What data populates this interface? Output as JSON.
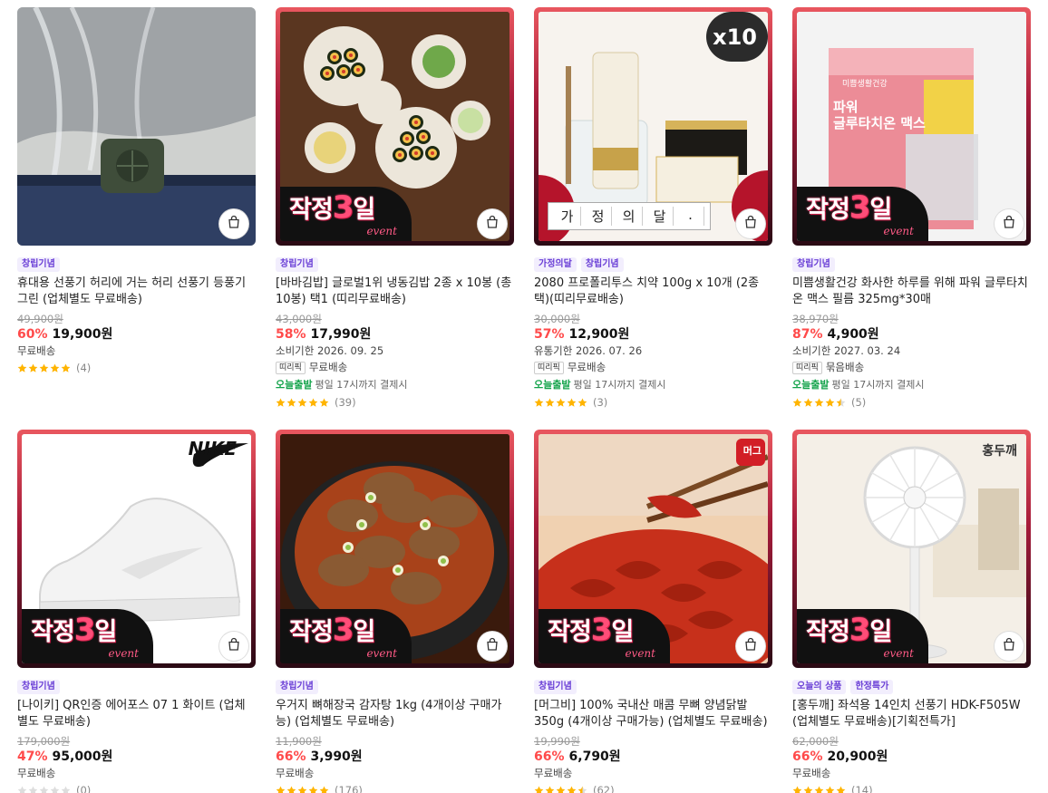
{
  "products": [
    {
      "tags": [
        "창립기념"
      ],
      "title": "휴대용 선풍기 허리에 거는 허리 선풍기 등풍기 그린 (업체별도 무료배송)",
      "original_price": "49,900원",
      "discount": "60%",
      "price": "19,900원",
      "expiry": "",
      "shipping_chip": "",
      "shipping": "무료배송",
      "today_label": "",
      "today_note": "",
      "rating": 5,
      "review_count": "(4)",
      "event_badge": false
    },
    {
      "tags": [
        "창립기념"
      ],
      "title": "[바바김밥] 글로벌1위 냉동김밥 2종 x 10봉 (총 10봉) 택1 (띠리무료배송)",
      "original_price": "43,000원",
      "discount": "58%",
      "price": "17,990원",
      "expiry": "소비기한 2026. 09. 25",
      "shipping_chip": "띠리픽",
      "shipping": "무료배송",
      "today_label": "오늘출발",
      "today_note": "평일 17시까지 결제시",
      "rating": 5,
      "review_count": "(39)",
      "event_badge": true
    },
    {
      "tags": [
        "가정의달",
        "창립기념"
      ],
      "title": "2080 프로폴리투스 치약 100g x 10개 (2종 택)(띠리무료배송)",
      "original_price": "30,000원",
      "discount": "57%",
      "price": "12,900원",
      "expiry": "유통기한 2026. 07. 26",
      "shipping_chip": "띠리픽",
      "shipping": "무료배송",
      "today_label": "오늘출발",
      "today_note": "평일 17시까지 결제시",
      "rating": 5,
      "review_count": "(3)",
      "event_badge": false,
      "overlay_count": "x10",
      "overlay_banner": [
        "가",
        "정",
        "의",
        "달",
        "."
      ]
    },
    {
      "tags": [
        "창립기념"
      ],
      "title": "미쁨생활건강 화사한 하루를 위해 파워 글루타치온 맥스 필름 325mg*30매",
      "original_price": "38,970원",
      "discount": "87%",
      "price": "4,900원",
      "expiry": "소비기한 2027. 03. 24",
      "shipping_chip": "띠리픽",
      "shipping": "묶음배송",
      "today_label": "오늘출발",
      "today_note": "평일 17시까지 결제시",
      "rating": 4.5,
      "review_count": "(5)",
      "event_badge": true,
      "box_brand": "미쁨생활건강",
      "box_title": "파워\n글루타치온 맥스"
    },
    {
      "tags": [
        "창립기념"
      ],
      "title": "[나이키] QR인증 에어포스 07 1 화이트 (업체별도 무료배송)",
      "original_price": "179,000원",
      "discount": "47%",
      "price": "95,000원",
      "expiry": "",
      "shipping_chip": "",
      "shipping": "무료배송",
      "today_label": "",
      "today_note": "",
      "rating": 0,
      "review_count": "(0)",
      "event_badge": true,
      "logo_text": "NIKE"
    },
    {
      "tags": [
        "창립기념"
      ],
      "title": "우거지 뼈해장국 감자탕 1kg (4개이상 구매가능) (업체별도 무료배송)",
      "original_price": "11,900원",
      "discount": "66%",
      "price": "3,990원",
      "expiry": "",
      "shipping_chip": "",
      "shipping": "무료배송",
      "today_label": "",
      "today_note": "",
      "rating": 5,
      "review_count": "(176)",
      "event_badge": true
    },
    {
      "tags": [
        "창립기념"
      ],
      "title": "[머그비] 100% 국내산 매콤 무뼈 양념닭발 350g (4개이상 구매가능) (업체별도 무료배송)",
      "original_price": "19,990원",
      "discount": "66%",
      "price": "6,790원",
      "expiry": "",
      "shipping_chip": "",
      "shipping": "무료배송",
      "today_label": "",
      "today_note": "",
      "rating": 4.5,
      "review_count": "(62)",
      "event_badge": true,
      "logo_text": "머그"
    },
    {
      "tags": [
        "오늘의 상품",
        "한정특가"
      ],
      "title": "[홍두깨] 좌석용 14인치 선풍기 HDK-F505W (업체별도 무료배송)[기획전특가]",
      "original_price": "62,000원",
      "discount": "66%",
      "price": "20,900원",
      "expiry": "",
      "shipping_chip": "",
      "shipping": "무료배송",
      "today_label": "",
      "today_note": "",
      "rating": 5,
      "review_count": "(14)",
      "event_badge": true,
      "logo_text": "홍두깨"
    }
  ],
  "event_badge": {
    "main_a": "작정",
    "num": "3",
    "main_b": "일",
    "sub": "event"
  },
  "colors": {
    "discount": "#ff4a4a",
    "star": "#ffb400",
    "tag_bg": "#f2eefd",
    "tag_text": "#6a3fd6",
    "today": "#13a34a",
    "frame": "#e9575f"
  },
  "icons": {
    "bag": "shopping-bag-icon",
    "star": "star-icon"
  }
}
